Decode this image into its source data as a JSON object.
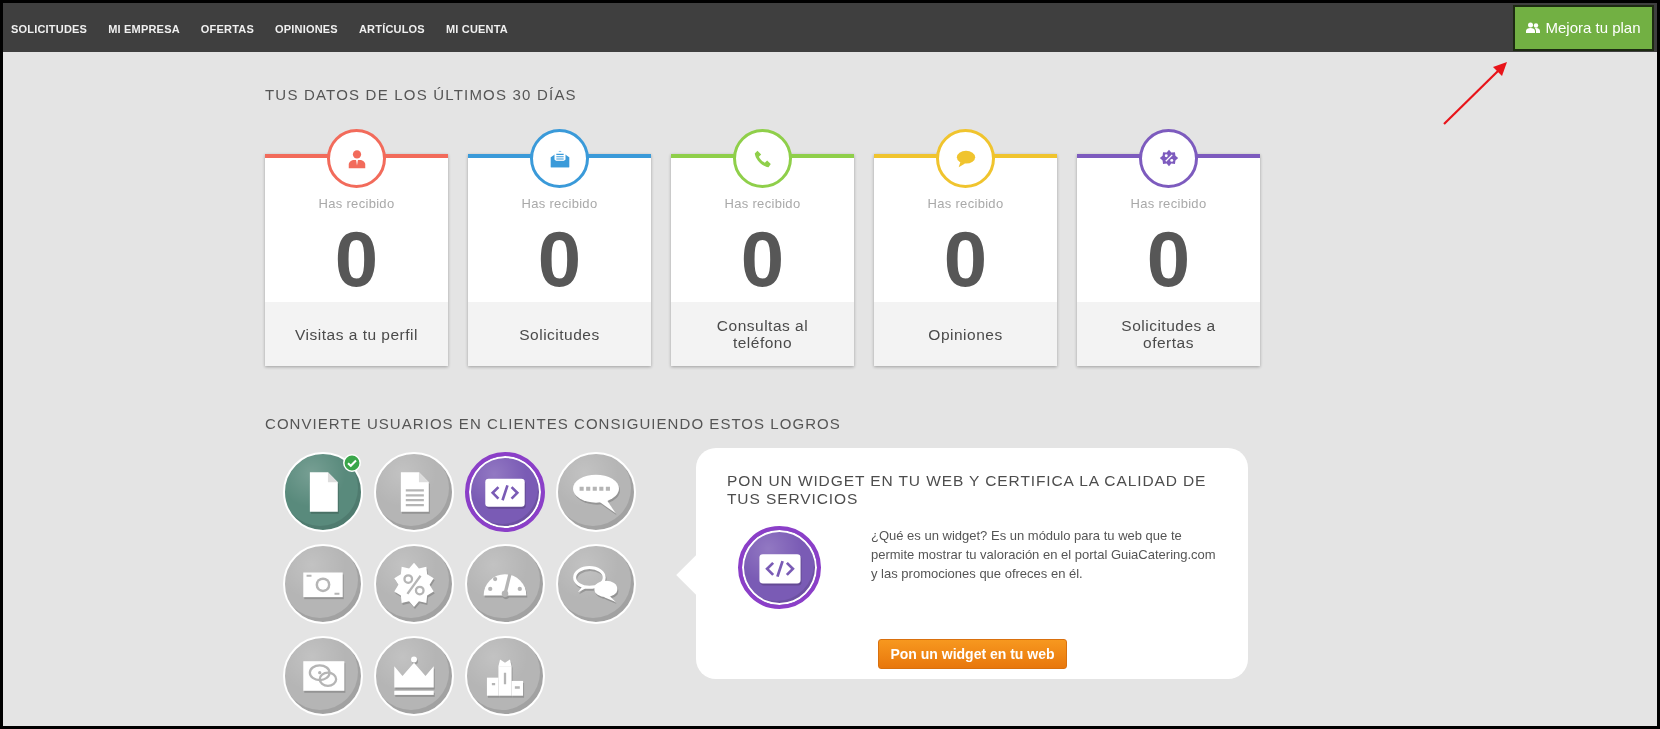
{
  "nav": {
    "items": [
      {
        "label": "SOLICITUDES"
      },
      {
        "label": "MI EMPRESA"
      },
      {
        "label": "OFERTAS"
      },
      {
        "label": "OPINIONES"
      },
      {
        "label": "ARTÍCULOS"
      },
      {
        "label": "MI CUENTA"
      }
    ],
    "upgrade_button": {
      "label": "Mejora tu plan"
    }
  },
  "stats": {
    "title": "TUS DATOS DE LOS ÚLTIMOS 30 DÍAS",
    "cards": [
      {
        "kind": "profile",
        "color": "#f26b5b",
        "caption": "Has recibido",
        "value": "0",
        "label": "Visitas a tu perfil"
      },
      {
        "kind": "envelope",
        "color": "#3a9ad9",
        "caption": "Has recibido",
        "value": "0",
        "label": "Solicitudes"
      },
      {
        "kind": "phone",
        "color": "#8fcf4a",
        "caption": "Has recibido",
        "value": "0",
        "label": "Consultas al teléfono"
      },
      {
        "kind": "speech",
        "color": "#f0c42e",
        "caption": "Has recibido",
        "value": "0",
        "label": "Opiniones"
      },
      {
        "kind": "discount",
        "color": "#7d5bbe",
        "caption": "Has recibido",
        "value": "0",
        "label": "Solicitudes a ofertas"
      }
    ]
  },
  "achievements": {
    "title": "CONVIERTE USUARIOS EN CLIENTES CONSIGUIENDO ESTOS LOGROS",
    "badges": [
      {
        "kind": "document",
        "achieved": true,
        "selected": false
      },
      {
        "kind": "text-document",
        "achieved": false,
        "selected": false
      },
      {
        "kind": "code",
        "achieved": false,
        "selected": true
      },
      {
        "kind": "rating",
        "achieved": false,
        "selected": false
      },
      {
        "kind": "banknote",
        "achieved": false,
        "selected": false
      },
      {
        "kind": "discount",
        "achieved": false,
        "selected": false
      },
      {
        "kind": "gauge",
        "achieved": false,
        "selected": false
      },
      {
        "kind": "chat",
        "achieved": false,
        "selected": false
      },
      {
        "kind": "question",
        "achieved": false,
        "selected": false
      },
      {
        "kind": "crown",
        "achieved": false,
        "selected": false
      },
      {
        "kind": "podium",
        "achieved": false,
        "selected": false
      }
    ]
  },
  "widget_panel": {
    "kind": "code",
    "heading": "PON UN WIDGET EN TU WEB Y CERTIFICA LA CALIDAD DE TUS SERVICIOS",
    "description": "¿Qué es un widget? Es un módulo para tu web que te permite mostrar tu valoración en el portal GuiaCatering.com y las promociones que ofreces en él.",
    "button": "Pon un widget en tu web"
  },
  "annotation": {
    "kind": "arrow"
  }
}
